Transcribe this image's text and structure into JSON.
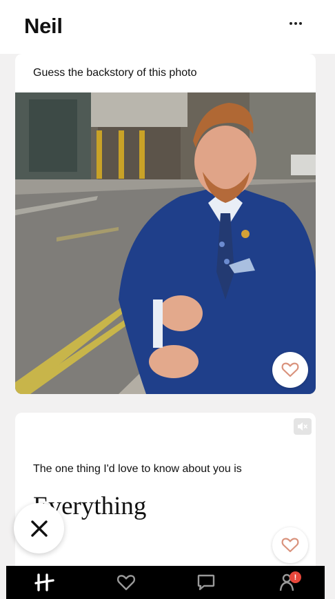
{
  "header": {
    "name": "Neil",
    "more_icon": "more-horizontal-icon"
  },
  "cards": [
    {
      "type": "photo",
      "prompt": "Guess the backstory of this photo",
      "photo_alt": "Man in a navy blue suit with a patterned tie adjusting his sleeve on a city street",
      "like_icon": "heart-outline-icon"
    },
    {
      "type": "prompt",
      "prompt": "The one thing I'd love to know about you is",
      "answer": "Everything",
      "mute_icon": "muted-speaker-icon",
      "like_icon": "heart-outline-icon"
    }
  ],
  "actions": {
    "dismiss_icon": "close-x-icon"
  },
  "tabbar": {
    "tabs": [
      {
        "name": "home",
        "icon": "hinge-logo-icon"
      },
      {
        "name": "likes",
        "icon": "heart-icon"
      },
      {
        "name": "chats",
        "icon": "chat-bubble-icon"
      },
      {
        "name": "profile",
        "icon": "person-icon",
        "badge": "!"
      }
    ]
  },
  "colors": {
    "accent_heart": "#d9927c",
    "badge": "#e8473b",
    "tabbar_bg": "#000000"
  }
}
